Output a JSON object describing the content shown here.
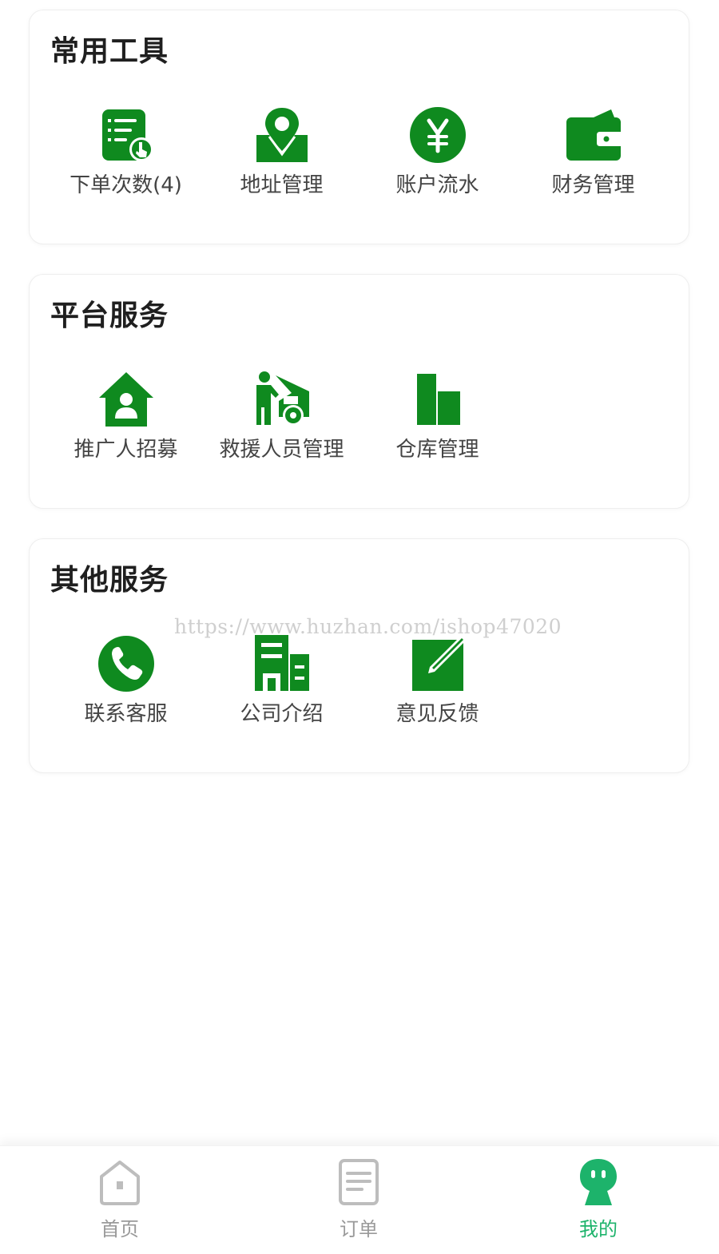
{
  "colors": {
    "primary": "#0f8a1f",
    "tab_active": "#1db36b",
    "tab_inactive": "#9a9a9a",
    "watermark": "#cfcfcf"
  },
  "sections": [
    {
      "title": "常用工具",
      "items": [
        {
          "label": "下单次数(4)",
          "icon": "order-list-icon"
        },
        {
          "label": "地址管理",
          "icon": "location-pin-icon"
        },
        {
          "label": "账户流水",
          "icon": "yen-coin-icon"
        },
        {
          "label": "财务管理",
          "icon": "wallet-icon"
        }
      ]
    },
    {
      "title": "平台服务",
      "items": [
        {
          "label": "推广人招募",
          "icon": "house-user-icon"
        },
        {
          "label": "救援人员管理",
          "icon": "mechanic-car-icon"
        },
        {
          "label": "仓库管理",
          "icon": "warehouse-icon"
        }
      ]
    },
    {
      "title": "其他服务",
      "items": [
        {
          "label": "联系客服",
          "icon": "phone-icon"
        },
        {
          "label": "公司介绍",
          "icon": "building-icon"
        },
        {
          "label": "意见反馈",
          "icon": "edit-note-icon"
        }
      ]
    }
  ],
  "watermark": "https://www.huzhan.com/ishop47020",
  "tabbar": {
    "tabs": [
      {
        "label": "首页",
        "icon": "home-icon",
        "active": false
      },
      {
        "label": "订单",
        "icon": "order-doc-icon",
        "active": false
      },
      {
        "label": "我的",
        "icon": "profile-icon",
        "active": true
      }
    ]
  }
}
